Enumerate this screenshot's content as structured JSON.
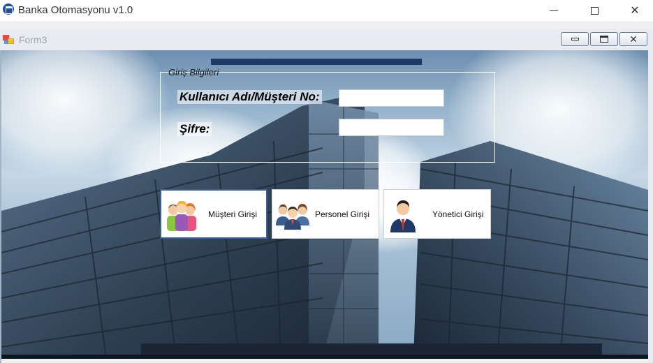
{
  "window": {
    "title": "Banka Otomasyonu v1.0",
    "icon": "bank-icon",
    "controls": [
      "minimize-icon",
      "maximize-icon",
      "close-icon"
    ]
  },
  "child_window": {
    "title": "Form3",
    "icon": "form-icon",
    "controls": [
      "minimize-icon",
      "restore-icon",
      "close-icon"
    ],
    "close_glyph": "✕"
  },
  "login_group": {
    "legend": "Giriş Bilgileri",
    "username_label": "Kullanıcı Adı/Müşteri No:",
    "username_value": "",
    "password_label": "Şifre:",
    "password_value": ""
  },
  "buttons": [
    {
      "label": "Müşteri Girişi",
      "icon": "customers-icon"
    },
    {
      "label": "Personel Girişi",
      "icon": "staff-icon"
    },
    {
      "label": "Yönetici Girişi",
      "icon": "manager-icon"
    }
  ],
  "colors": {
    "accent_bar": "#1b3c66",
    "active_button_border": "#3a5f9a"
  }
}
